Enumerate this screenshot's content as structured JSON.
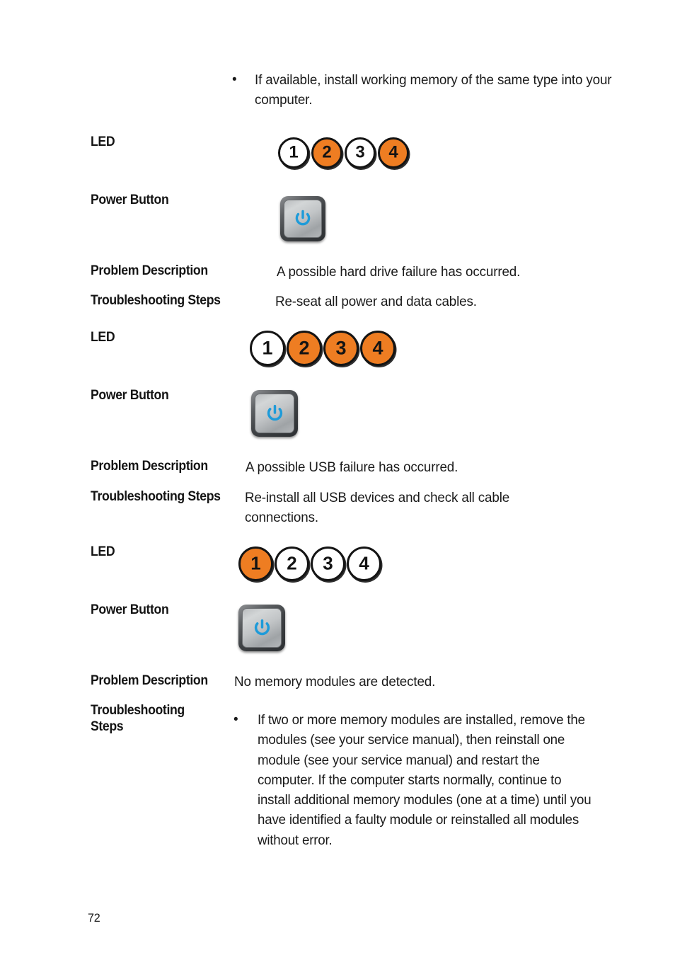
{
  "document": {
    "page_number": "72",
    "top_bullet": {
      "marker": "•",
      "text": "If available, install working memory of the same type into your computer."
    },
    "sections": [
      {
        "led_label": "LED",
        "led_states": [
          {
            "number": "1",
            "state": "off"
          },
          {
            "number": "2",
            "state": "on"
          },
          {
            "number": "3",
            "state": "off"
          },
          {
            "number": "4",
            "state": "on"
          }
        ],
        "power_button_label": "Power Button",
        "power_button_icon": "power-icon",
        "problem_description_label": "Problem Description",
        "problem_description_text": "A possible hard drive failure has occurred.",
        "troubleshooting_label": "Troubleshooting Steps",
        "troubleshooting_text": "Re-seat all power and data cables."
      },
      {
        "led_label": "LED",
        "led_states": [
          {
            "number": "1",
            "state": "off"
          },
          {
            "number": "2",
            "state": "on"
          },
          {
            "number": "3",
            "state": "on"
          },
          {
            "number": "4",
            "state": "on"
          }
        ],
        "power_button_label": "Power Button",
        "power_button_icon": "power-icon",
        "problem_description_label": "Problem Description",
        "problem_description_text": "A possible USB failure has occurred.",
        "troubleshooting_label": "Troubleshooting Steps",
        "troubleshooting_text": "Re-install all USB devices and check all cable connections."
      },
      {
        "led_label": "LED",
        "led_states": [
          {
            "number": "1",
            "state": "on"
          },
          {
            "number": "2",
            "state": "off"
          },
          {
            "number": "3",
            "state": "off"
          },
          {
            "number": "4",
            "state": "off"
          }
        ],
        "power_button_label": "Power Button",
        "power_button_icon": "power-icon",
        "problem_description_label": "Problem Description",
        "problem_description_text": "No memory modules are detected.",
        "troubleshooting_label": "Troubleshooting\nSteps",
        "troubleshooting_bullet_marker": "•",
        "troubleshooting_bullet_text": "If two or more memory modules are installed, remove the modules (see your service manual), then reinstall one module (see your service manual) and restart the computer. If the computer starts normally, continue to install additional memory modules (one at a time) until you have identified a faulty module or reinstalled all modules without error."
      }
    ]
  },
  "colors": {
    "led_on": "#ee7d22",
    "led_off": "#ffffff",
    "led_outline": "#141414",
    "power_icon_blue": "#1e9bd9",
    "text": "#1a1a1a",
    "page_background": "#ffffff"
  }
}
